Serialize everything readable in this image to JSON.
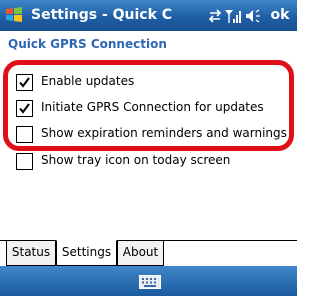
{
  "titlebar": {
    "title": "Settings - Quick C",
    "ok_label": "ok",
    "icons": [
      "windows-logo-icon",
      "connectivity-icon",
      "signal-icon",
      "volume-icon"
    ]
  },
  "section": {
    "heading": "Quick GPRS Connection"
  },
  "options": [
    {
      "label": "Enable updates",
      "checked": true
    },
    {
      "label": "Initiate GPRS Connection for updates",
      "checked": true
    },
    {
      "label": "Show expiration reminders and warnings",
      "checked": false
    },
    {
      "label": "Show tray icon on today screen",
      "checked": false
    }
  ],
  "tabs": [
    {
      "label": "Status",
      "active": false
    },
    {
      "label": "Settings",
      "active": true
    },
    {
      "label": "About",
      "active": false
    }
  ],
  "menubar": {
    "icon": "keyboard-icon"
  },
  "colors": {
    "title_bar": "#1f5fa6",
    "heading": "#2d66b4",
    "highlight": "#e0101a"
  }
}
